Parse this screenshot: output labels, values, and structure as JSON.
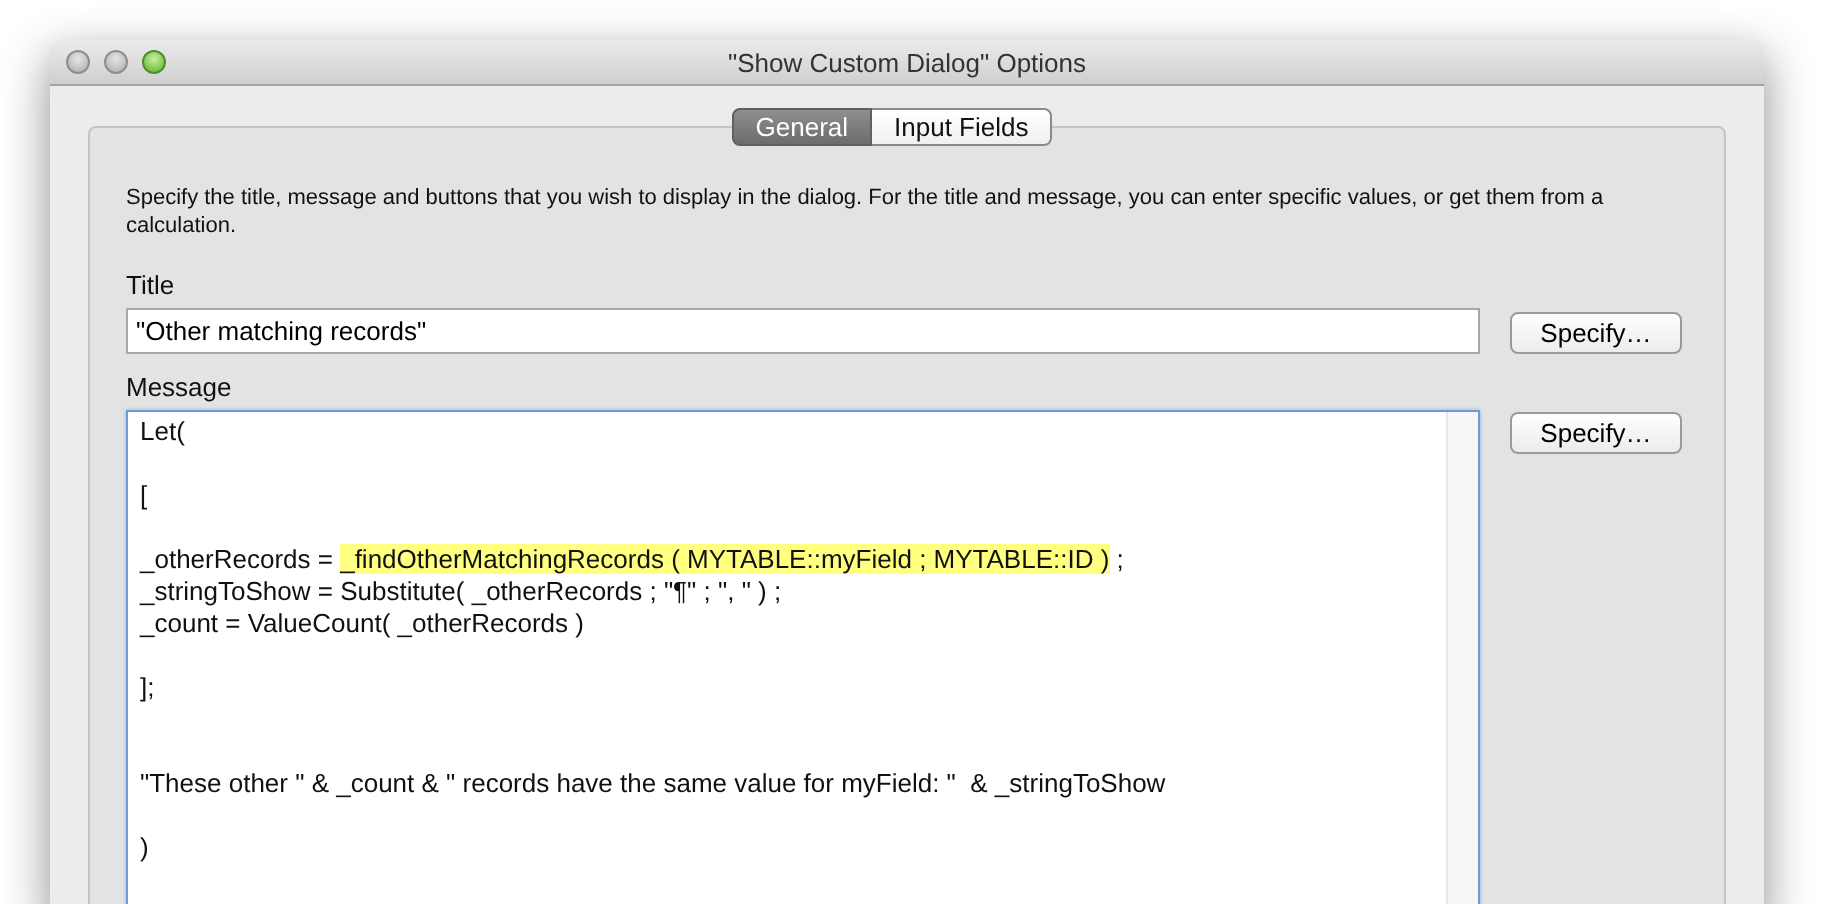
{
  "window": {
    "title": "\"Show Custom Dialog\" Options"
  },
  "tabs": [
    {
      "label": "General",
      "selected": true
    },
    {
      "label": "Input Fields",
      "selected": false
    }
  ],
  "description": "Specify the title, message and buttons that you wish to display in the dialog. For the title and message, you can enter specific values, or get them from a calculation.",
  "title_section": {
    "label": "Title",
    "value": "\"Other matching records\"",
    "button": "Specify…"
  },
  "message_section": {
    "label": "Message",
    "button": "Specify…",
    "lines": [
      {
        "kind": "code",
        "segments": [
          {
            "text": "Let(",
            "highlighted": false
          }
        ]
      },
      {
        "kind": "blank"
      },
      {
        "kind": "code",
        "segments": [
          {
            "text": "[",
            "highlighted": false
          }
        ]
      },
      {
        "kind": "blank"
      },
      {
        "kind": "code",
        "segments": [
          {
            "text": "_otherRecords = ",
            "highlighted": false
          },
          {
            "text": "_findOtherMatchingRecords ( MYTABLE::myField ; MYTABLE::ID )",
            "highlighted": true
          },
          {
            "text": " ;",
            "highlighted": false
          }
        ]
      },
      {
        "kind": "code",
        "segments": [
          {
            "text": "_stringToShow = Substitute( _otherRecords ; \"¶\" ; \", \" ) ;",
            "highlighted": false
          }
        ]
      },
      {
        "kind": "code",
        "segments": [
          {
            "text": "_count = ValueCount( _otherRecords )",
            "highlighted": false
          }
        ]
      },
      {
        "kind": "blank"
      },
      {
        "kind": "code",
        "segments": [
          {
            "text": "];",
            "highlighted": false
          }
        ]
      },
      {
        "kind": "blank"
      },
      {
        "kind": "blank"
      },
      {
        "kind": "code",
        "segments": [
          {
            "text": "\"These other \" & _count & \" records have the same value for myField: \"  & _stringToShow",
            "highlighted": false
          }
        ]
      },
      {
        "kind": "blank"
      },
      {
        "kind": "code",
        "segments": [
          {
            "text": ")",
            "highlighted": false
          }
        ]
      }
    ]
  }
}
